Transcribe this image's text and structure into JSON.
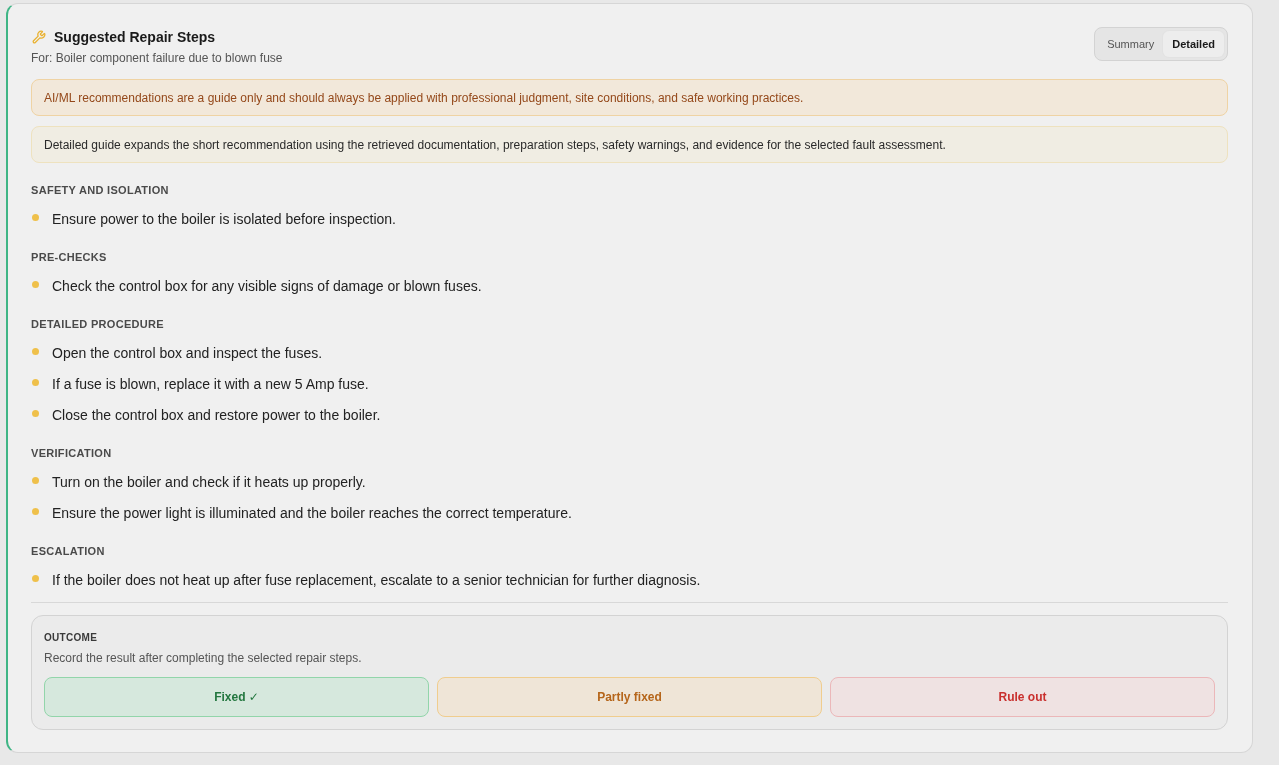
{
  "header": {
    "title": "Suggested Repair Steps",
    "subtitle": "For: Boiler component failure due to blown fuse"
  },
  "view_toggle": [
    {
      "label": "Summary",
      "selected": false
    },
    {
      "label": "Detailed",
      "selected": true
    }
  ],
  "notices": [
    {
      "kind": "warning",
      "text": "AI/ML recommendations are a guide only and should always be applied with professional judgment, site conditions, and safe working practices."
    },
    {
      "kind": "info",
      "text": "Detailed guide expands the short recommendation using the retrieved documentation, preparation steps, safety warnings, and evidence for the selected fault assessment."
    }
  ],
  "sections": [
    {
      "heading": "SAFETY AND ISOLATION",
      "steps": [
        "Ensure power to the boiler is isolated before inspection."
      ]
    },
    {
      "heading": "PRE-CHECKS",
      "steps": [
        "Check the control box for any visible signs of damage or blown fuses."
      ]
    },
    {
      "heading": "DETAILED PROCEDURE",
      "steps": [
        "Open the control box and inspect the fuses.",
        "If a fuse is blown, replace it with a new 5 Amp fuse.",
        "Close the control box and restore power to the boiler."
      ]
    },
    {
      "heading": "VERIFICATION",
      "steps": [
        "Turn on the boiler and check if it heats up properly.",
        "Ensure the power light is illuminated and the boiler reaches the correct temperature."
      ]
    },
    {
      "heading": "ESCALATION",
      "steps": [
        "If the boiler does not heat up after fuse replacement, escalate to a senior technician for further diagnosis."
      ]
    }
  ],
  "outcome": {
    "heading": "OUTCOME",
    "description": "Record the result after completing the selected repair steps.",
    "buttons": [
      {
        "kind": "fixed",
        "label": "Fixed ✓"
      },
      {
        "kind": "partial",
        "label": "Partly fixed"
      },
      {
        "kind": "ruleout",
        "label": "Rule out"
      }
    ]
  }
}
